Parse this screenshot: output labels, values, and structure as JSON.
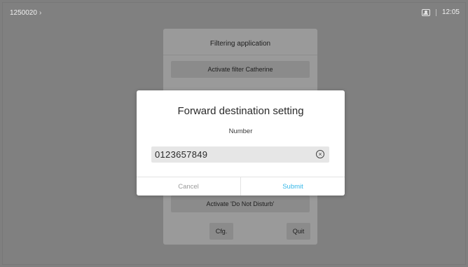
{
  "status_bar": {
    "number": "1250020",
    "chevron": "›",
    "contact_icon": "contact-icon",
    "time": "12:05"
  },
  "background_panel": {
    "title": "Filtering application",
    "activate_filter_label": "Activate filter Catherine",
    "activate_dnd_label": "Activate 'Do Not Disturb'",
    "cfg_label": "Cfg.",
    "quit_label": "Quit"
  },
  "dialog": {
    "title": "Forward destination setting",
    "field_label": "Number",
    "field_value": "0123657849",
    "clear_icon": "clear-icon",
    "cancel_label": "Cancel",
    "submit_label": "Submit"
  },
  "colors": {
    "accent": "#35b7e8",
    "overlay": "#808080"
  }
}
